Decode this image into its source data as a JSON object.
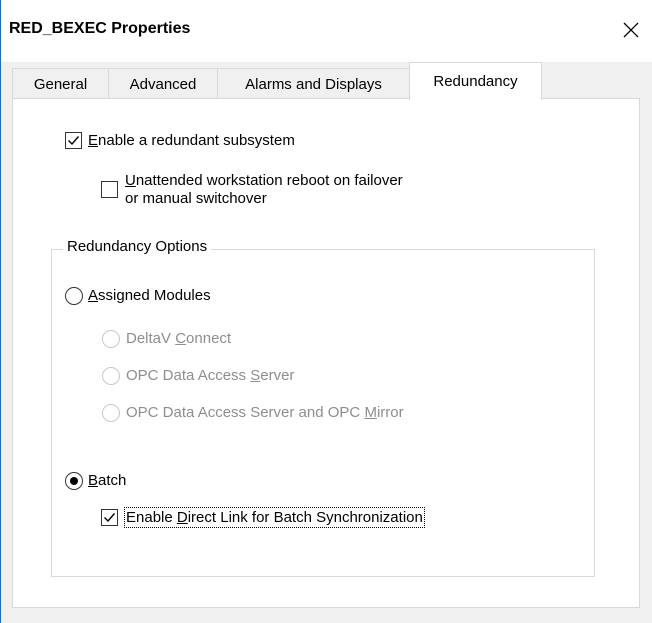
{
  "window": {
    "title": "RED_BEXEC Properties",
    "close_icon": "close-icon",
    "accent_border": "#1e6fb5"
  },
  "tabs": [
    {
      "label": "General",
      "active": false
    },
    {
      "label": "Advanced",
      "active": false
    },
    {
      "label": "Alarms and Displays",
      "active": false
    },
    {
      "label": "Redundancy",
      "active": true
    }
  ],
  "redundancy": {
    "enable_subsystem": {
      "mnemonic": "E",
      "rest": "nable a redundant subsystem",
      "checked": true
    },
    "unattended_reboot": {
      "mnemonic": "U",
      "line1_rest": "nattended workstation reboot on failover",
      "line2": "or manual switchover",
      "checked": false
    },
    "options_group": {
      "title": "Redundancy Options",
      "assigned_modules": {
        "mnemonic": "A",
        "rest": "ssigned Modules",
        "selected": false
      },
      "sub_options": [
        {
          "before": "DeltaV ",
          "mnemonic": "C",
          "after": "onnect",
          "enabled": false
        },
        {
          "before": "OPC Data Access ",
          "mnemonic": "S",
          "after": "erver",
          "enabled": false
        },
        {
          "before": "OPC Data Access Server and OPC ",
          "mnemonic": "M",
          "after": "irror",
          "enabled": false
        }
      ],
      "batch": {
        "mnemonic": "B",
        "rest": "atch",
        "selected": true
      },
      "direct_link": {
        "before": "Enable ",
        "mnemonic": "D",
        "after": "irect Link for Batch Synchronization",
        "checked": true
      }
    }
  }
}
